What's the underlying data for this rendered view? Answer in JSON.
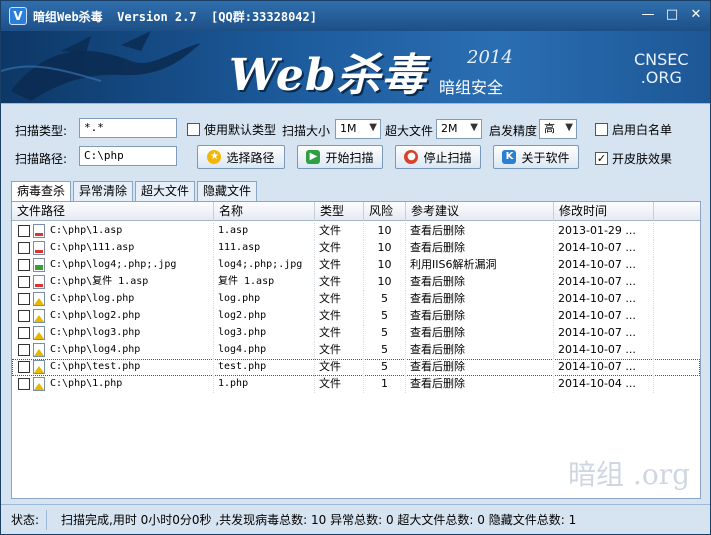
{
  "window": {
    "title": "暗组Web杀毒  Version 2.7  [QQ群:33328042]",
    "app_icon": "V",
    "minimize": "—",
    "maximize": "□",
    "close": "✕"
  },
  "banner": {
    "title": "Web杀毒",
    "year": "2014",
    "subtitle": "暗组安全",
    "site_line1": "CNSEC",
    "site_line2": ".ORG"
  },
  "controls": {
    "scan_type_label": "扫描类型:",
    "scan_type_value": "*.*",
    "default_type_label": "使用默认类型",
    "scan_size_label": "扫描大小",
    "scan_size_value": "1M",
    "big_file_label": "超大文件",
    "big_file_value": "2M",
    "heuristic_label": "启发精度",
    "heuristic_value": "高",
    "whitelist_label": "启用白名单",
    "scan_path_label": "扫描路径:",
    "scan_path_value": "C:\\php",
    "choose_path_btn": "选择路径",
    "start_scan_btn": "开始扫描",
    "stop_scan_btn": "停止扫描",
    "about_btn": "关于软件",
    "skin_label": "开皮肤效果",
    "skin_checked": true
  },
  "tabs": [
    "病毒查杀",
    "异常清除",
    "超大文件",
    "隐藏文件"
  ],
  "table": {
    "headers": [
      "文件路径",
      "名称",
      "类型",
      "风险",
      "参考建议",
      "修改时间"
    ],
    "rows": [
      {
        "path": "C:\\php\\1.asp",
        "name": "1.asp",
        "type": "文件",
        "risk": "10",
        "advice": "查看后删除",
        "time": "2013-01-29 ...",
        "icon": "asp"
      },
      {
        "path": "C:\\php\\111.asp",
        "name": "111.asp",
        "type": "文件",
        "risk": "10",
        "advice": "查看后删除",
        "time": "2014-10-07 ...",
        "icon": "asp"
      },
      {
        "path": "C:\\php\\log4;.php;.jpg",
        "name": "log4;.php;.jpg",
        "type": "文件",
        "risk": "10",
        "advice": "利用IIS6解析漏洞",
        "time": "2014-10-07 ...",
        "icon": "jpg"
      },
      {
        "path": "C:\\php\\复件 1.asp",
        "name": "复件 1.asp",
        "type": "文件",
        "risk": "10",
        "advice": "查看后删除",
        "time": "2014-10-07 ...",
        "icon": "asp"
      },
      {
        "path": "C:\\php\\log.php",
        "name": "log.php",
        "type": "文件",
        "risk": "5",
        "advice": "查看后删除",
        "time": "2014-10-07 ...",
        "icon": "php"
      },
      {
        "path": "C:\\php\\log2.php",
        "name": "log2.php",
        "type": "文件",
        "risk": "5",
        "advice": "查看后删除",
        "time": "2014-10-07 ...",
        "icon": "php"
      },
      {
        "path": "C:\\php\\log3.php",
        "name": "log3.php",
        "type": "文件",
        "risk": "5",
        "advice": "查看后删除",
        "time": "2014-10-07 ...",
        "icon": "php"
      },
      {
        "path": "C:\\php\\log4.php",
        "name": "log4.php",
        "type": "文件",
        "risk": "5",
        "advice": "查看后删除",
        "time": "2014-10-07 ...",
        "icon": "php"
      },
      {
        "path": "C:\\php\\test.php",
        "name": "test.php",
        "type": "文件",
        "risk": "5",
        "advice": "查看后删除",
        "time": "2014-10-07 ...",
        "icon": "php"
      },
      {
        "path": "C:\\php\\1.php",
        "name": "1.php",
        "type": "文件",
        "risk": "1",
        "advice": "查看后删除",
        "time": "2014-10-04 ...",
        "icon": "php"
      }
    ]
  },
  "watermark": "暗组 .org",
  "status": {
    "label": "状态:",
    "message": "扫描完成,用时 0小时0分0秒 ,共发现病毒总数: 10 异常总数: 0 超大文件总数: 0 隐藏文件总数: 1"
  }
}
